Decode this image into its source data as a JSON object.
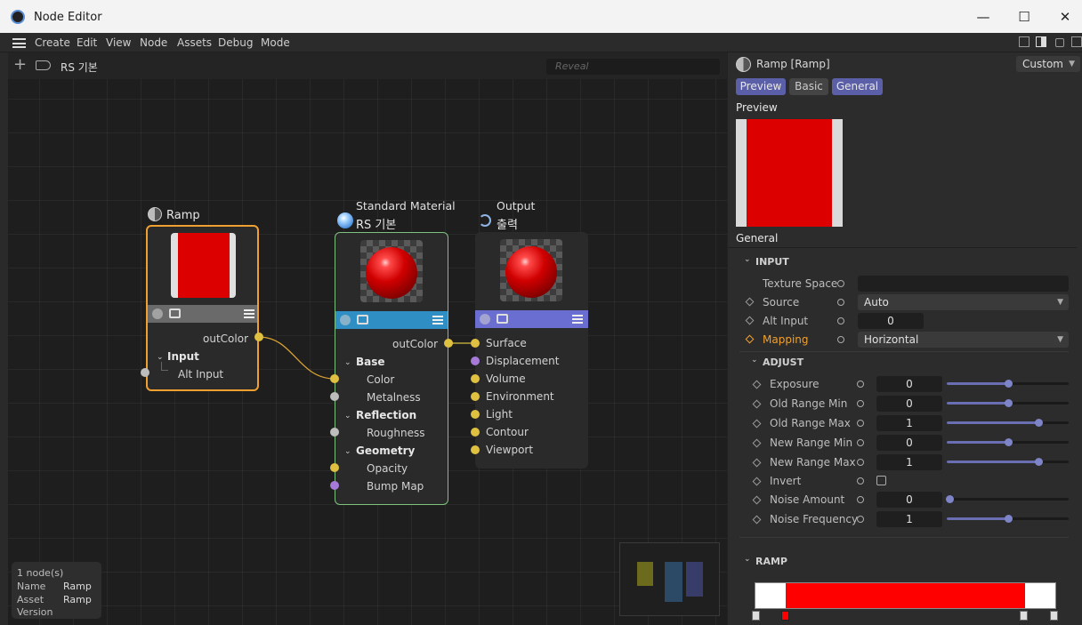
{
  "window": {
    "title": "Node Editor",
    "min": "—",
    "max": "☐",
    "close": "✕"
  },
  "menu": {
    "items": [
      "Create",
      "Edit",
      "View",
      "Node",
      "Assets",
      "Debug",
      "Mode"
    ]
  },
  "graph": {
    "breadcrumb": "RS 기본",
    "search_placeholder": "Reveal"
  },
  "nodes": {
    "ramp": {
      "title": "Ramp",
      "out_port": "outColor",
      "group": "Input",
      "in_port": "Alt Input"
    },
    "material": {
      "type_label": "Standard Material",
      "title": "RS 기본",
      "out_port": "outColor",
      "groups": [
        {
          "label": "Base",
          "ports": [
            "Color",
            "Metalness"
          ]
        },
        {
          "label": "Reflection",
          "ports": [
            "Roughness"
          ]
        },
        {
          "label": "Geometry",
          "ports": [
            "Opacity",
            "Bump Map"
          ]
        }
      ]
    },
    "output": {
      "type_label": "Output",
      "title": "출력",
      "ports": [
        "Surface",
        "Displacement",
        "Volume",
        "Environment",
        "Light",
        "Contour",
        "Viewport"
      ]
    }
  },
  "info": {
    "count": "1 node(s)",
    "name_label": "Name",
    "name_value": "Ramp",
    "asset_label": "Asset",
    "asset_value": "Ramp",
    "version_label": "Version"
  },
  "panel": {
    "title": "Ramp [Ramp]",
    "mode": "Custom",
    "tabs": [
      "Preview",
      "Basic",
      "General"
    ],
    "preview_label": "Preview",
    "general_label": "General",
    "input_section": "INPUT",
    "adjust_section": "ADJUST",
    "ramp_section": "RAMP",
    "input_params": [
      {
        "label": "Texture Space",
        "value": ""
      },
      {
        "label": "Source",
        "value": "Auto"
      },
      {
        "label": "Alt Input",
        "value": "0"
      },
      {
        "label": "Mapping",
        "value": "Horizontal"
      }
    ],
    "adjust_params": [
      {
        "label": "Exposure",
        "value": "0",
        "level": 0.5
      },
      {
        "label": "Old Range Min",
        "value": "0",
        "level": 0.5
      },
      {
        "label": "Old Range Max",
        "value": "1",
        "level": 0.75
      },
      {
        "label": "New Range Min",
        "value": "0",
        "level": 0.5
      },
      {
        "label": "New Range Max",
        "value": "1",
        "level": 0.75
      },
      {
        "label": "Invert",
        "value": ""
      },
      {
        "label": "Noise Amount",
        "value": "0",
        "level": 0.02
      },
      {
        "label": "Noise Frequency",
        "value": "1",
        "level": 0.5
      }
    ]
  },
  "colors": {
    "accent": "#5a5fa8",
    "ramp_red": "#e00000",
    "material_header": "#2f8fc4",
    "output_header": "#6a6ed0",
    "ramp_border": "#f0a030",
    "material_border": "#7fc27f"
  }
}
